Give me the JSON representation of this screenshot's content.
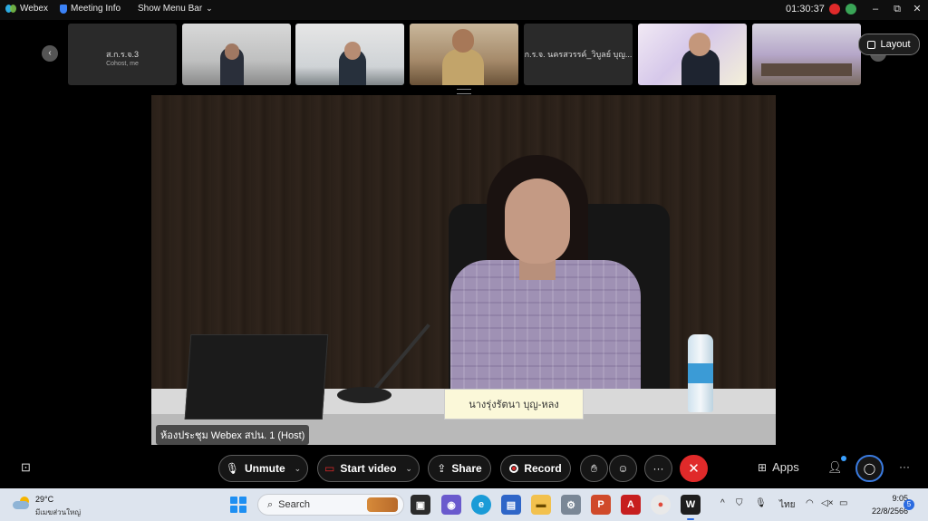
{
  "titlebar": {
    "app_name": "Webex",
    "meeting_info": "Meeting Info",
    "show_menu_bar": "Show Menu Bar",
    "timer": "01:30:37",
    "minimize": "–",
    "restore": "⧉",
    "close": "✕"
  },
  "filmstrip": {
    "participants": [
      {
        "name": "ส.ก.ร.จ.3",
        "subtitle": "Cohost, me"
      },
      {
        "name": "",
        "subtitle": ""
      },
      {
        "name": "",
        "subtitle": ""
      },
      {
        "name": "",
        "subtitle": ""
      },
      {
        "name": "ก.ร.จ. นครสวรรค์_วิบูลย์ บุญ...",
        "subtitle": ""
      },
      {
        "name": "",
        "subtitle": ""
      },
      {
        "name": "",
        "subtitle": ""
      }
    ],
    "layout_label": "Layout",
    "prev_arrow": "‹",
    "next_arrow": "›"
  },
  "main_video": {
    "nameplate": "นางรุ่งรัตนา บุญ-หลง",
    "label": "ห้องประชุม Webex สปน. 1 (Host)"
  },
  "controls": {
    "captions_icon": "⊡",
    "unmute": "Unmute",
    "start_video": "Start video",
    "share": "Share",
    "record": "Record",
    "more": "···",
    "apps": "Apps",
    "overflow": "···",
    "chevron": "⌄"
  },
  "taskbar": {
    "weather_temp": "29°C",
    "weather_desc": "มีเมฆส่วนใหญ่",
    "search_placeholder": "Search",
    "language": "ไทย",
    "time": "9:05",
    "date": "22/8/2566",
    "notifications": "5",
    "tray_arrow": "^"
  },
  "colors": {
    "end_call": "#e02a2a",
    "record_dot": "#e02a2a",
    "accent_blue": "#2b6be0",
    "taskbar_bg": "#dde4ee"
  }
}
